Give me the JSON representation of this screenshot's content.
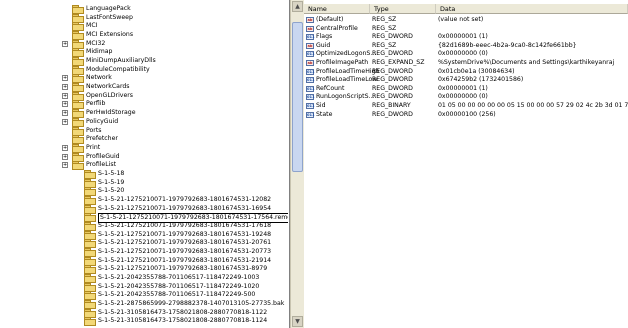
{
  "tree": {
    "items": [
      {
        "label": "LanguagePack",
        "expander": false,
        "indent": 0
      },
      {
        "label": "LastFontSweep",
        "expander": false,
        "indent": 0
      },
      {
        "label": "MCI",
        "expander": false,
        "indent": 0
      },
      {
        "label": "MCI Extensions",
        "expander": false,
        "indent": 0
      },
      {
        "label": "MCI32",
        "expander": true,
        "indent": 0
      },
      {
        "label": "Midimap",
        "expander": false,
        "indent": 0
      },
      {
        "label": "MiniDumpAuxiliaryDlls",
        "expander": false,
        "indent": 0
      },
      {
        "label": "ModuleCompatibility",
        "expander": false,
        "indent": 0
      },
      {
        "label": "Network",
        "expander": true,
        "indent": 0
      },
      {
        "label": "NetworkCards",
        "expander": true,
        "indent": 0
      },
      {
        "label": "OpenGLDrivers",
        "expander": true,
        "indent": 0
      },
      {
        "label": "Perflib",
        "expander": true,
        "indent": 0
      },
      {
        "label": "PerHwIdStorage",
        "expander": true,
        "indent": 0
      },
      {
        "label": "PolicyGuid",
        "expander": true,
        "indent": 0
      },
      {
        "label": "Ports",
        "expander": false,
        "indent": 0
      },
      {
        "label": "Prefetcher",
        "expander": false,
        "indent": 0
      },
      {
        "label": "Print",
        "expander": true,
        "indent": 0
      },
      {
        "label": "ProfileGuid",
        "expander": true,
        "indent": 0
      },
      {
        "label": "ProfileList",
        "expander": true,
        "indent": 0
      },
      {
        "label": "S-1-5-18",
        "expander": false,
        "indent": 1
      },
      {
        "label": "S-1-5-19",
        "expander": false,
        "indent": 1
      },
      {
        "label": "S-1-5-20",
        "expander": false,
        "indent": 1
      },
      {
        "label": "S-1-5-21-1275210071-1979792683-1801674531-12082",
        "expander": false,
        "indent": 1
      },
      {
        "label": "S-1-5-21-1275210071-1979792683-1801674531-16954",
        "expander": false,
        "indent": 1
      },
      {
        "label": "S-1-5-21-1275210071-1979792683-1801674531-17564.remove",
        "expander": false,
        "indent": 1,
        "selected": true
      },
      {
        "label": "S-1-5-21-1275210071-1979792683-1801674531-17618",
        "expander": false,
        "indent": 1
      },
      {
        "label": "S-1-5-21-1275210071-1979792683-1801674531-19248",
        "expander": false,
        "indent": 1
      },
      {
        "label": "S-1-5-21-1275210071-1979792683-1801674531-20761",
        "expander": false,
        "indent": 1
      },
      {
        "label": "S-1-5-21-1275210071-1979792683-1801674531-20773",
        "expander": false,
        "indent": 1
      },
      {
        "label": "S-1-5-21-1275210071-1979792683-1801674531-21914",
        "expander": false,
        "indent": 1
      },
      {
        "label": "S-1-5-21-1275210071-1979792683-1801674531-8979",
        "expander": false,
        "indent": 1
      },
      {
        "label": "S-1-5-21-2042355788-701106517-118472249-1003",
        "expander": false,
        "indent": 1
      },
      {
        "label": "S-1-5-21-2042355788-701106517-118472249-1020",
        "expander": false,
        "indent": 1
      },
      {
        "label": "S-1-5-21-2042355788-701106517-118472249-500",
        "expander": false,
        "indent": 1
      },
      {
        "label": "S-1-5-21-2875865999-2798882378-1407013105-27735.bak",
        "expander": false,
        "indent": 1
      },
      {
        "label": "S-1-5-21-3105816473-1758021808-2880770818-1122",
        "expander": false,
        "indent": 1
      },
      {
        "label": "S-1-5-21-3105816473-1758021808-2880770818-1124",
        "expander": false,
        "indent": 1
      }
    ]
  },
  "columns": {
    "name": "Name",
    "type": "Type",
    "data": "Data"
  },
  "values": [
    {
      "name": "(Default)",
      "type": "REG_SZ",
      "data": "(value not set)",
      "icon": "sz"
    },
    {
      "name": "CentralProfile",
      "type": "REG_SZ",
      "data": "",
      "icon": "sz"
    },
    {
      "name": "Flags",
      "type": "REG_DWORD",
      "data": "0x00000001 (1)",
      "icon": "bin"
    },
    {
      "name": "Guid",
      "type": "REG_SZ",
      "data": "{82d1689b-eeec-4b2a-9ca0-8c142fe661bb}",
      "icon": "sz"
    },
    {
      "name": "OptimizedLogonS...",
      "type": "REG_DWORD",
      "data": "0x00000000 (0)",
      "icon": "bin"
    },
    {
      "name": "ProfileImagePath",
      "type": "REG_EXPAND_SZ",
      "data": "%SystemDrive%\\Documents and Settings\\karthikeyanraj",
      "icon": "sz"
    },
    {
      "name": "ProfileLoadTimeHigh",
      "type": "REG_DWORD",
      "data": "0x01cb0e1a (30084634)",
      "icon": "bin"
    },
    {
      "name": "ProfileLoadTimeLow",
      "type": "REG_DWORD",
      "data": "0x674259b2 (1732401586)",
      "icon": "bin"
    },
    {
      "name": "RefCount",
      "type": "REG_DWORD",
      "data": "0x00000001 (1)",
      "icon": "bin"
    },
    {
      "name": "RunLogonScriptS...",
      "type": "REG_DWORD",
      "data": "0x00000000 (0)",
      "icon": "bin"
    },
    {
      "name": "Sid",
      "type": "REG_BINARY",
      "data": "01 05 00 00 00 00 00 05 15 00 00 00 57 29 02 4c 2b 3d 01 7...",
      "icon": "bin"
    },
    {
      "name": "State",
      "type": "REG_DWORD",
      "data": "0x00000100 (256)",
      "icon": "bin"
    }
  ]
}
